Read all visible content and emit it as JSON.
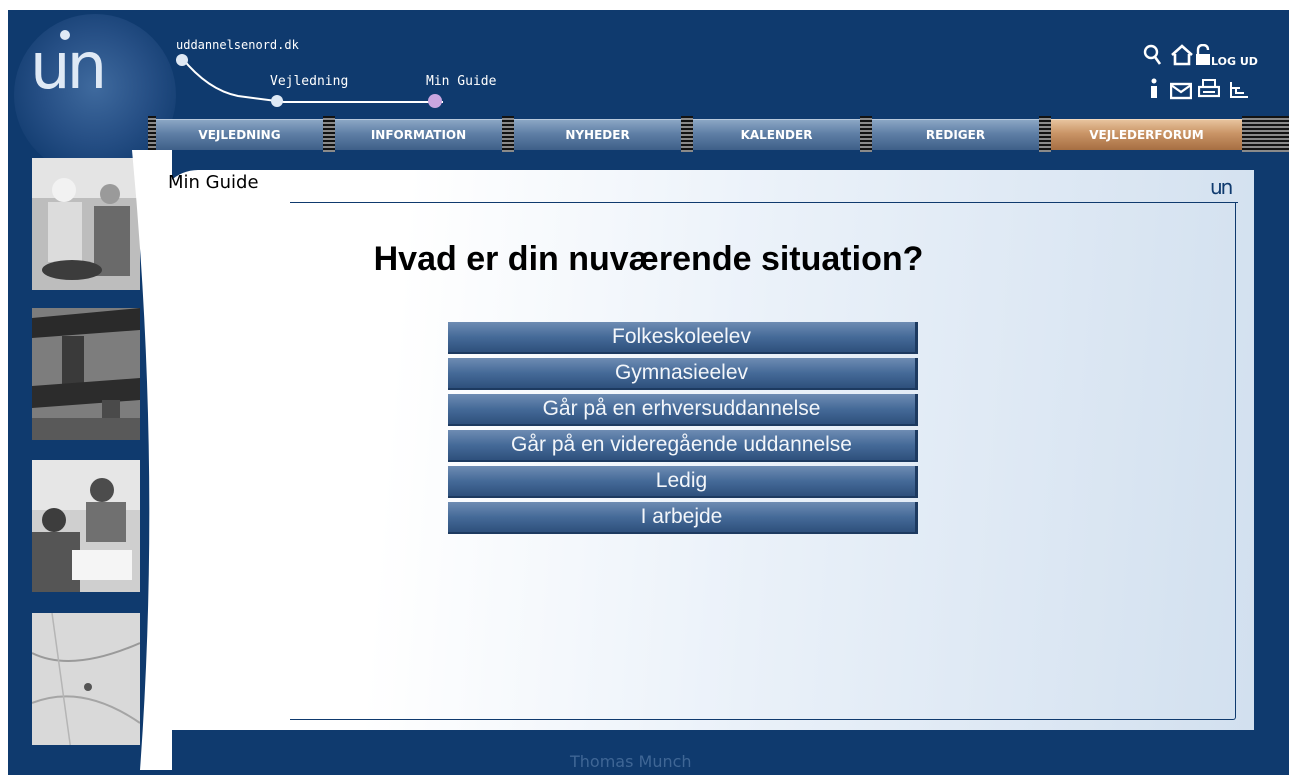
{
  "header": {
    "logo_text": "un",
    "site_name": "uddannelsenord.dk",
    "breadcrumb": [
      "Vejledning",
      "Min Guide"
    ],
    "breadcrumb_colors": {
      "start": "#dfe9f5",
      "current": "#c9a6e0"
    },
    "logout_label": "LOG UD",
    "icons_top": [
      "search-icon",
      "home-icon",
      "padlock-icon"
    ],
    "icons_bottom": [
      "info-icon",
      "mail-icon",
      "print-icon",
      "sitemap-icon"
    ]
  },
  "nav": {
    "tabs": [
      {
        "label": "VEJLEDNING",
        "active": false
      },
      {
        "label": "INFORMATION",
        "active": false
      },
      {
        "label": "NYHEDER",
        "active": false
      },
      {
        "label": "KALENDER",
        "active": false
      },
      {
        "label": "REDIGER",
        "active": false
      },
      {
        "label": "VEJLEDERFORUM",
        "active": true
      }
    ]
  },
  "main": {
    "page_title": "Min Guide",
    "mini_logo": "un",
    "question": "Hvad er din nuværende situation?",
    "choices": [
      "Folkeskoleelev",
      "Gymnasieelev",
      "Går på en erhversuddannelse",
      "Går på en videregående uddannelse",
      "Ledig",
      "I arbejde"
    ]
  },
  "footer": {
    "user_name": "Thomas Munch"
  },
  "colors": {
    "background": "#0f3a6e",
    "active_tab": "#c99466",
    "button": "#456a98"
  }
}
